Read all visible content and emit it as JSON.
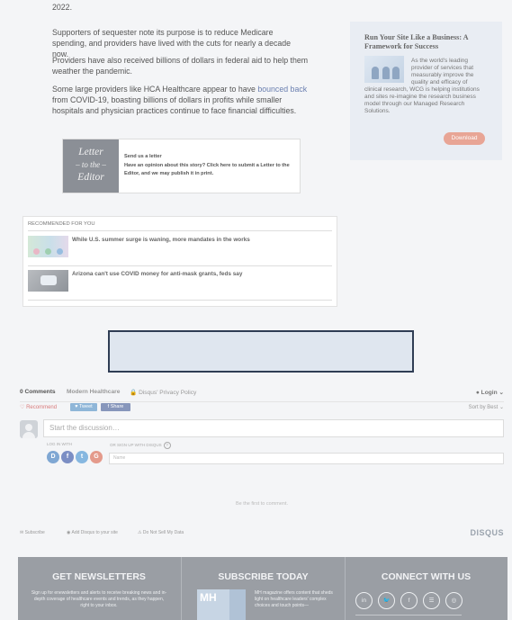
{
  "article": {
    "cutoff_line": "2022.",
    "p1": "Supporters of sequester note its purpose is to reduce Medicare spending, and providers have lived with the cuts for nearly a decade now.",
    "p2": "Providers have also received billions of dollars in federal aid to help them weather the pandemic.",
    "p3_before": "Some large providers like HCA Healthcare appear to have ",
    "p3_link": "bounced back",
    "p3_after": " from COVID-19, boasting billions of dollars in profits while smaller hospitals and physician practices continue to face financial difficulties."
  },
  "sidebar_ad": {
    "title": "Run Your Site Like a Business: A Framework for Success",
    "body_indent": "As the world's leading provider of services that measurably improve the quality and efficacy of",
    "body_rest": "clinical research, WCG is helping institutions and sites re-imagine the research business model through our Managed Research Solutions.",
    "button": "Download"
  },
  "letter": {
    "badge_line1": "Letter",
    "badge_line2": "– to the –",
    "badge_line3": "Editor",
    "heading": "Send us a letter",
    "text": "Have an opinion about this story? Click here to submit a Letter to the Editor, and we may publish it in print."
  },
  "recommended": {
    "header": "RECOMMENDED FOR YOU",
    "items": [
      {
        "title": "While U.S. summer surge is waning, more mandates in the works"
      },
      {
        "title": "Arizona can't use COVID money for anti-mask grants, feds say"
      }
    ]
  },
  "disqus": {
    "count": "0 Comments",
    "site": "Modern Healthcare",
    "privacy": "Disqus' Privacy Policy",
    "login": "Login",
    "recommend": "Recommend",
    "tweet": "Tweet",
    "share": "Share",
    "sort": "Sort by Best",
    "input_placeholder": "Start the discussion…",
    "log_in_with": "LOG IN WITH",
    "sign_up_with": "OR SIGN UP WITH DISQUS",
    "name_placeholder": "Name",
    "first": "Be the first to comment.",
    "subscribe": "Subscribe",
    "add_disqus": "Add Disqus to your site",
    "dnsmd": "Do Not Sell My Data",
    "brand": "DISQUS"
  },
  "footer": {
    "newsletters_title": "GET NEWSLETTERS",
    "newsletters_desc": "Sign up for enewsletters and alerts to receive breaking news and in-depth coverage of healthcare events and trends, as they happen, right to your inbox.",
    "subscribe_title": "SUBSCRIBE TODAY",
    "subscribe_logo": "MH",
    "subscribe_desc": "MH magazine offers content that sheds light on healthcare leaders' complex choices and touch points—",
    "connect_title": "CONNECT WITH US",
    "social_icons": [
      "in",
      "t",
      "f",
      "rss",
      "ig"
    ]
  }
}
